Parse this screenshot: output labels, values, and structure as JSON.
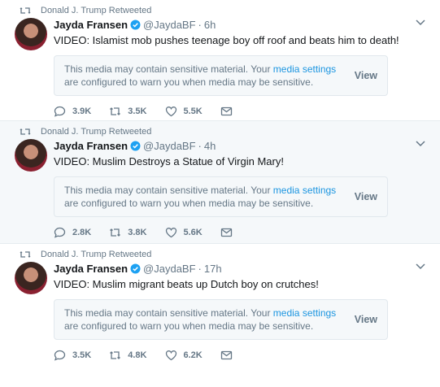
{
  "tweets": [
    {
      "retweeted_by": "Donald J. Trump Retweeted",
      "name": "Jayda Fransen",
      "handle": "@JaydaBF",
      "time": "6h",
      "text": "VIDEO: Islamist mob pushes teenage boy off roof and beats him to death!",
      "warning_prefix": "This media may contain sensitive material. Your ",
      "warning_link": "media settings",
      "warning_suffix": " are configured to warn you when media may be sensitive.",
      "view_label": "View",
      "replies": "3.9K",
      "retweets": "3.5K",
      "likes": "5.5K"
    },
    {
      "retweeted_by": "Donald J. Trump Retweeted",
      "name": "Jayda Fransen",
      "handle": "@JaydaBF",
      "time": "4h",
      "text": "VIDEO: Muslim Destroys a Statue of Virgin Mary!",
      "warning_prefix": "This media may contain sensitive material. Your ",
      "warning_link": "media settings",
      "warning_suffix": " are configured to warn you when media may be sensitive.",
      "view_label": "View",
      "replies": "2.8K",
      "retweets": "3.8K",
      "likes": "5.6K"
    },
    {
      "retweeted_by": "Donald J. Trump Retweeted",
      "name": "Jayda Fransen",
      "handle": "@JaydaBF",
      "time": "17h",
      "text": "VIDEO: Muslim migrant beats up Dutch boy on crutches!",
      "warning_prefix": "This media may contain sensitive material. Your ",
      "warning_link": "media settings",
      "warning_suffix": " are configured to warn you when media may be sensitive.",
      "view_label": "View",
      "replies": "3.5K",
      "retweets": "4.8K",
      "likes": "6.2K"
    }
  ],
  "colors": {
    "link": "#1b95e0",
    "muted": "#657786",
    "verified": "#1da1f2"
  },
  "icons": [
    "retweet-icon",
    "verified-badge-icon",
    "chevron-down-icon",
    "reply-icon",
    "like-icon",
    "direct-message-icon"
  ]
}
